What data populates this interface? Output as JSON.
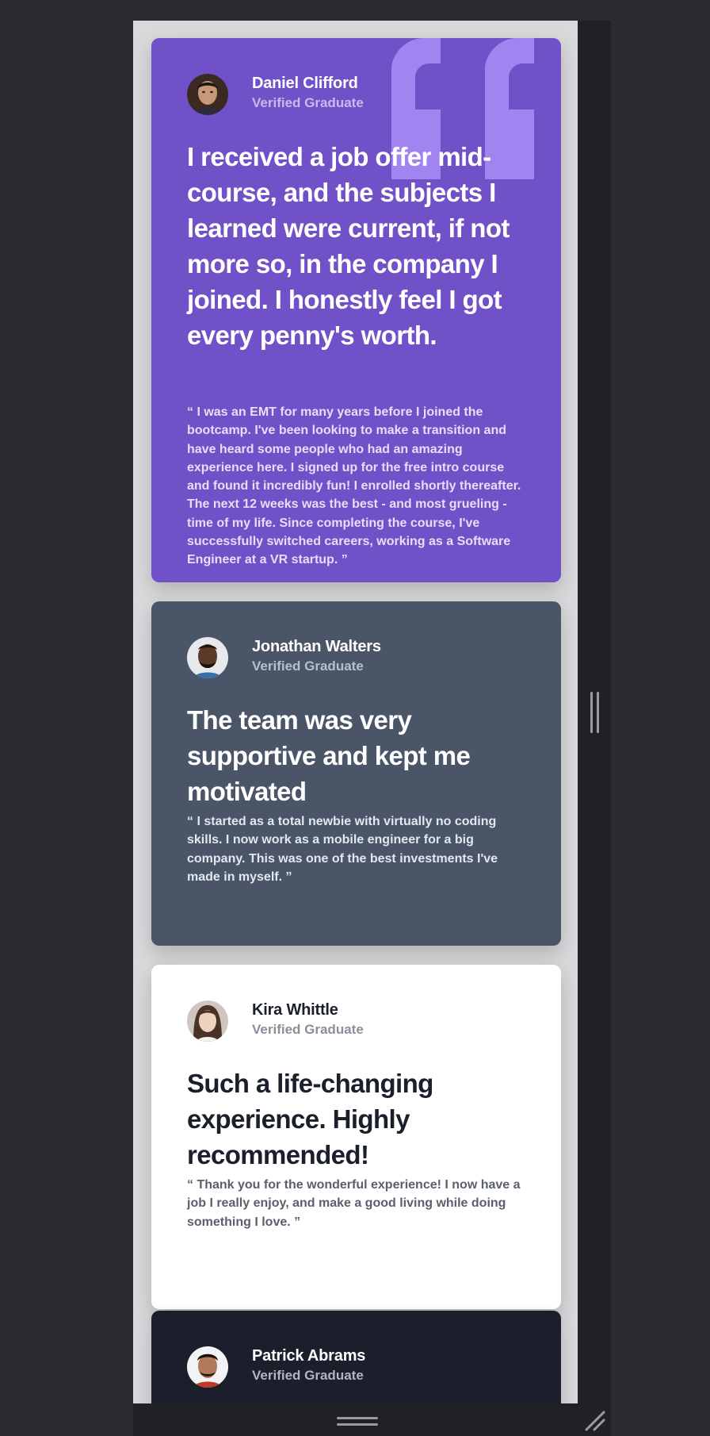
{
  "testimonials": [
    {
      "name": "Daniel Clifford",
      "role": "Verified Graduate",
      "headline": "I received a job offer mid-course, and the subjects I learned were current, if not more so, in the company I joined. I honestly feel I got every penny's worth.",
      "quote": "“ I was an EMT for many years before I joined the bootcamp. I've been looking to make a transition and have heard some people who had an amazing experience here. I signed up for the free intro course and found it incredibly fun! I enrolled shortly thereafter. The next 12 weeks was the best - and most grueling - time of my life. Since completing the course, I've successfully switched careers, working as a Software Engineer at a VR startup. ”",
      "avatar_icon": "avatar-daniel-icon",
      "decoration_icon": "quotation-mark-icon"
    },
    {
      "name": "Jonathan Walters",
      "role": "Verified Graduate",
      "headline": "The team was very supportive and kept me motivated",
      "quote": "“ I started as a total newbie with virtually no coding skills. I now work as a mobile engineer for a big company. This was one of the best investments I've made in myself. ”",
      "avatar_icon": "avatar-jonathan-icon"
    },
    {
      "name": "Kira Whittle",
      "role": "Verified Graduate",
      "headline": "Such a life-changing experience. Highly recommended!",
      "quote": "“ Thank you for the wonderful experience! I now have a job I really enjoy, and make a good living while doing something I love. ”",
      "avatar_icon": "avatar-kira-icon"
    },
    {
      "name": "Patrick Abrams",
      "role": "Verified Graduate",
      "avatar_icon": "avatar-patrick-icon"
    }
  ],
  "colors": {
    "purple_card": "#7051c8",
    "slate_card": "#4a5568",
    "white_card": "#ffffff",
    "dark_card": "#1a1f2b",
    "quote_mark": "#a184f0",
    "page_background": "#d9d9db"
  },
  "window_controls": {
    "side_handle": "vertical-resize-handle-icon",
    "bottom_handle": "horizontal-resize-handle-icon",
    "corner": "resize-corner-icon"
  }
}
